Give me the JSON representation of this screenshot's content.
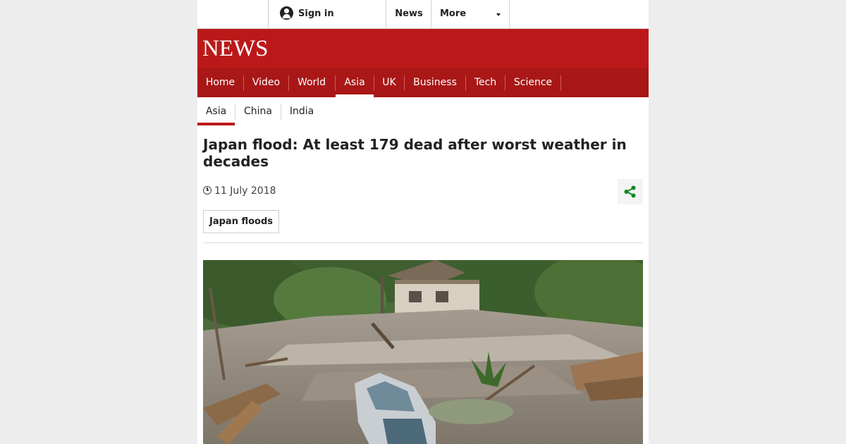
{
  "topbar": {
    "sign_in": "Sign in",
    "news": "News",
    "more": "More"
  },
  "masthead": {
    "logo": "NEWS",
    "brand_color": "#bb1919"
  },
  "primary_nav": [
    {
      "label": "Home"
    },
    {
      "label": "Video"
    },
    {
      "label": "World"
    },
    {
      "label": "Asia",
      "active": true
    },
    {
      "label": "UK"
    },
    {
      "label": "Business"
    },
    {
      "label": "Tech"
    },
    {
      "label": "Science"
    }
  ],
  "secondary_nav": [
    {
      "label": "Asia",
      "active": true
    },
    {
      "label": "China"
    },
    {
      "label": "India"
    }
  ],
  "article": {
    "headline": "Japan flood: At least 179 dead after worst weather in decades",
    "date": "11 July 2018",
    "tag": "Japan floods",
    "share_color": "#0a8a1e"
  },
  "icons": [
    "avatar-icon",
    "caret-down-icon",
    "clock-icon",
    "share-icon"
  ]
}
